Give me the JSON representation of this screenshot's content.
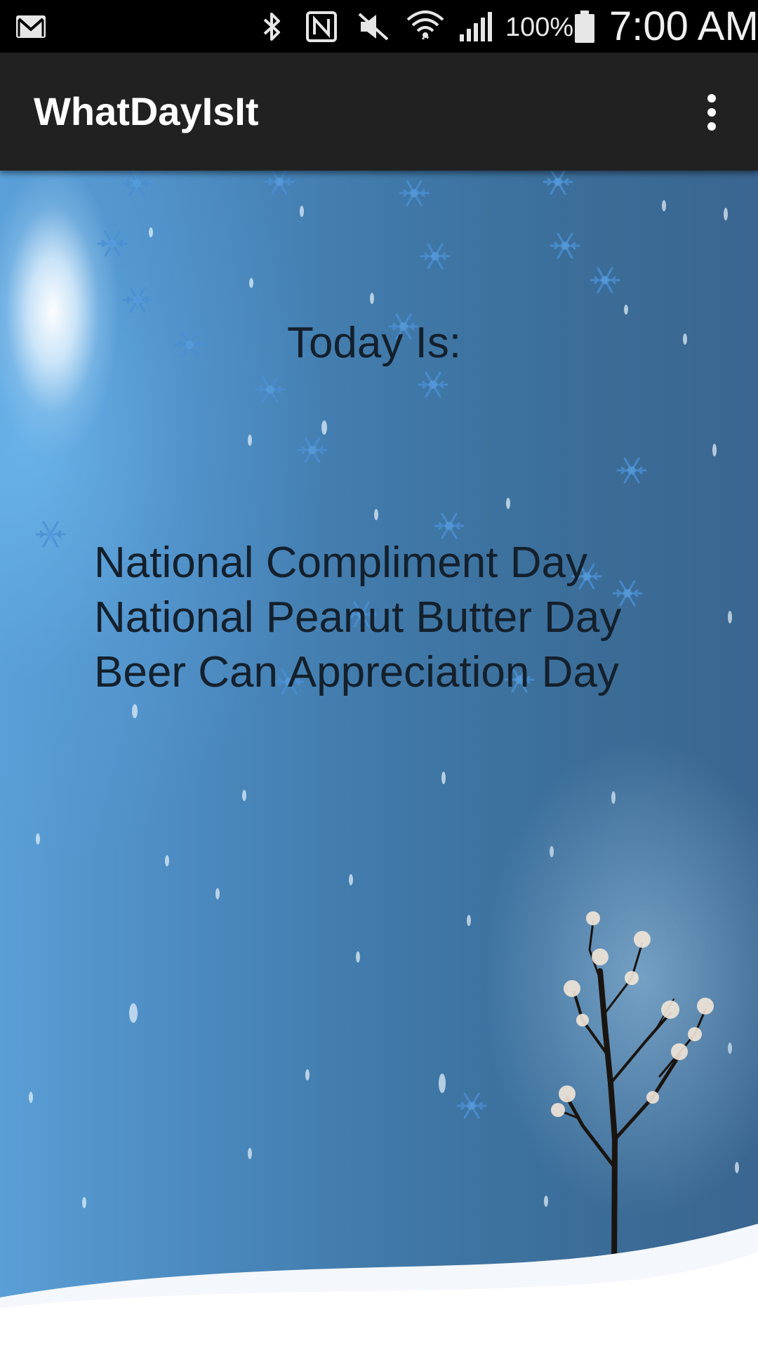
{
  "status_bar": {
    "battery_percent": "100%",
    "time": "7:00 AM",
    "icons": [
      "gmail-icon",
      "bluetooth-icon",
      "nfc-icon",
      "mute-icon",
      "wifi-icon",
      "signal-icon",
      "battery-icon"
    ]
  },
  "action_bar": {
    "title": "WhatDayIsIt",
    "overflow_icon": "more-vert-icon"
  },
  "main": {
    "heading": "Today Is:",
    "holidays": [
      "National Compliment Day",
      "National Peanut Butter Day",
      "Beer Can Appreciation Day"
    ]
  },
  "colors": {
    "status_bar_bg": "#000000",
    "action_bar_bg": "#212121",
    "text_primary": "#14202c",
    "sky_light": "#5a9fd6",
    "sky_dark": "#3a6690",
    "snowflake": "#4a8fd4"
  }
}
